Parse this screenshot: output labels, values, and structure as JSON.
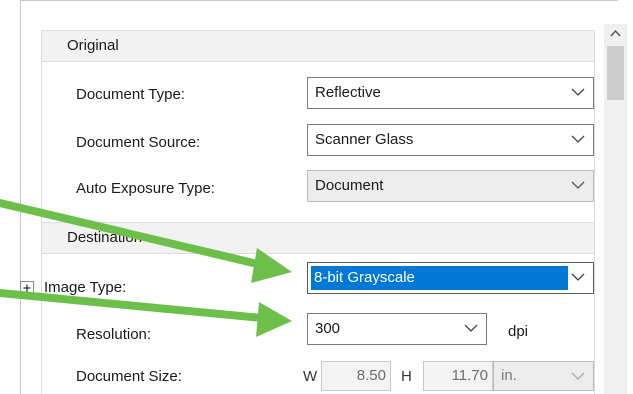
{
  "sections": {
    "original": "Original",
    "destination": "Destination"
  },
  "fields": {
    "document_type": {
      "label": "Document Type:",
      "value": "Reflective"
    },
    "document_source": {
      "label": "Document Source:",
      "value": "Scanner Glass"
    },
    "auto_exposure": {
      "label": "Auto Exposure Type:",
      "value": "Document"
    },
    "image_type": {
      "label": "Image Type:",
      "value": "8-bit Grayscale"
    },
    "resolution": {
      "label": "Resolution:",
      "value": "300",
      "unit": "dpi"
    },
    "document_size": {
      "label": "Document Size:",
      "w_label": "W",
      "w_value": "8.50",
      "h_label": "H",
      "h_value": "11.70",
      "unit": "in."
    }
  },
  "icons": {
    "expand": "plus-icon",
    "dropdown": "chevron-down-icon",
    "scroll_up": "chevron-up-icon"
  },
  "colors": {
    "arrow": "#6cc04a",
    "highlight": "#0078d7"
  }
}
